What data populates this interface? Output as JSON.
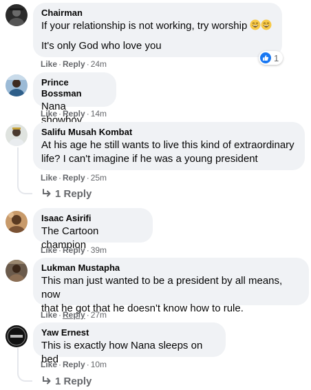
{
  "comments": [
    {
      "author": "Chairman",
      "lines": [
        "If your relationship is not working, try worship",
        "It's only God who love you"
      ],
      "emojis": [
        "grinning-face-emoji",
        "grinning-face-emoji"
      ],
      "like_label": "Like",
      "reply_label": "Reply",
      "time": "24m",
      "reaction_count": "1"
    },
    {
      "author": "Prince Bossman",
      "lines": [
        "Nana showboy"
      ],
      "like_label": "Like",
      "reply_label": "Reply",
      "time": "14m"
    },
    {
      "author": "Salifu Musah Kombat",
      "lines": [
        "At his age he still wants to live this kind of extraordinary",
        "life? I can't imagine if he was a young president"
      ],
      "like_label": "Like",
      "reply_label": "Reply",
      "time": "25m",
      "replies_label": "1 Reply"
    },
    {
      "author": "Isaac Asirifi",
      "lines": [
        "The Cartoon champion"
      ],
      "like_label": "Like",
      "reply_label": "Reply",
      "time": "39m"
    },
    {
      "author": "Lukman Mustapha",
      "lines": [
        "This man just wanted to be a president by all means, now",
        "that he got that he doesn't know how to rule."
      ],
      "like_label": "Like",
      "reply_label": "Reply",
      "time": "27m"
    },
    {
      "author": "Yaw Ernest",
      "lines": [
        "This is exactly how Nana sleeps on bed"
      ],
      "like_label": "Like",
      "reply_label": "Reply",
      "time": "10m",
      "replies_label": "1 Reply"
    }
  ],
  "colors": {
    "bubble": "#f0f2f5",
    "meta_text": "#65676b",
    "like_blue": "#1877f2",
    "thread_line": "#e4e6eb"
  }
}
